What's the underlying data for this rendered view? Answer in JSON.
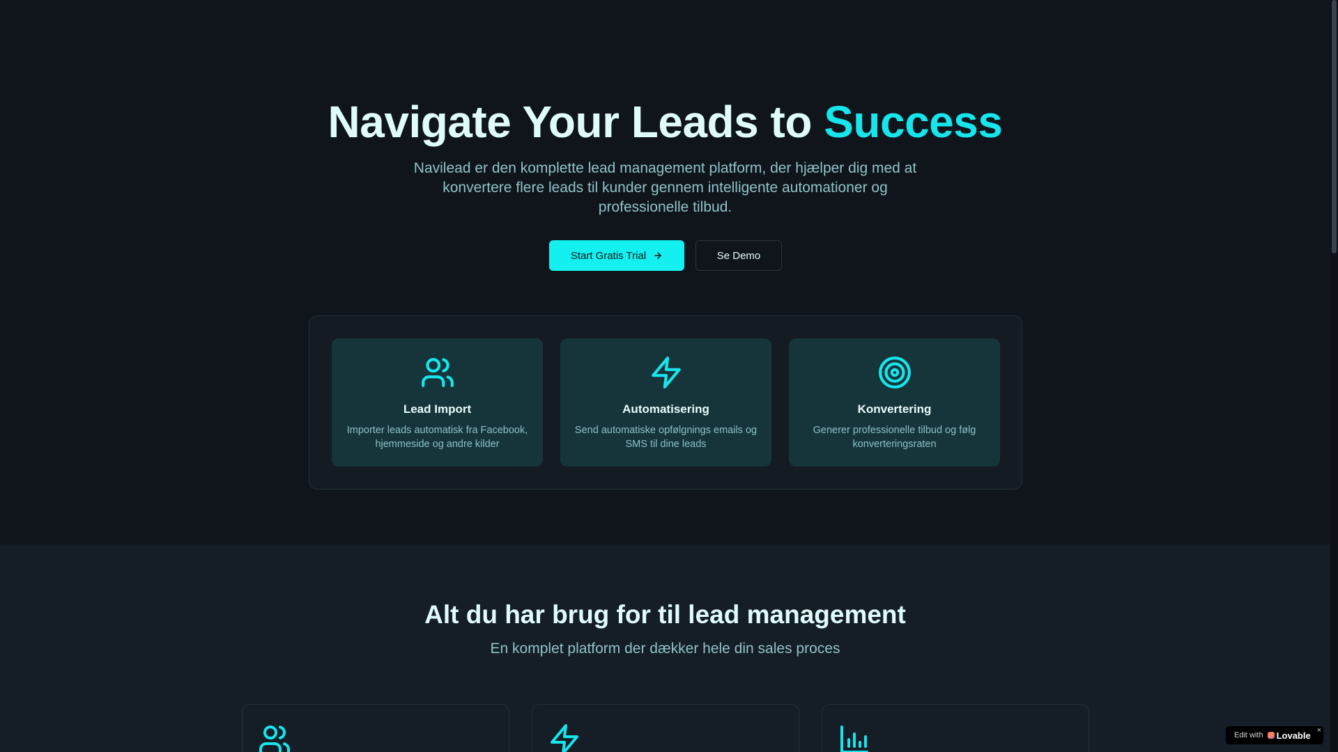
{
  "hero": {
    "title_main": "Navigate Your Leads to ",
    "title_accent": "Success",
    "subtitle": "Navilead er den komplette lead management platform, der hjælper dig med at konvertere flere leads til kunder gennem intelligente automationer og professionelle tilbud.",
    "primary_button": "Start Gratis Trial",
    "secondary_button": "Se Demo"
  },
  "features": [
    {
      "icon": "users-icon",
      "title": "Lead Import",
      "desc": "Importer leads automatisk fra Facebook, hjemmeside og andre kilder"
    },
    {
      "icon": "lightning-icon",
      "title": "Automatisering",
      "desc": "Send automatiske opfølgnings emails og SMS til dine leads"
    },
    {
      "icon": "target-icon",
      "title": "Konvertering",
      "desc": "Generer professionelle tilbud og følg konverteringsraten"
    }
  ],
  "section2": {
    "title": "Alt du har brug for til lead management",
    "subtitle": "En komplet platform der dækker hele din sales proces",
    "cards": [
      {
        "icon": "users-icon"
      },
      {
        "icon": "lightning-icon"
      },
      {
        "icon": "bar-chart-icon"
      }
    ]
  },
  "badge": {
    "prefix": "Edit with",
    "brand": "Lovable",
    "close": "×"
  },
  "colors": {
    "accent": "#16e6ec",
    "background": "#10151c",
    "card": "#16353b"
  }
}
